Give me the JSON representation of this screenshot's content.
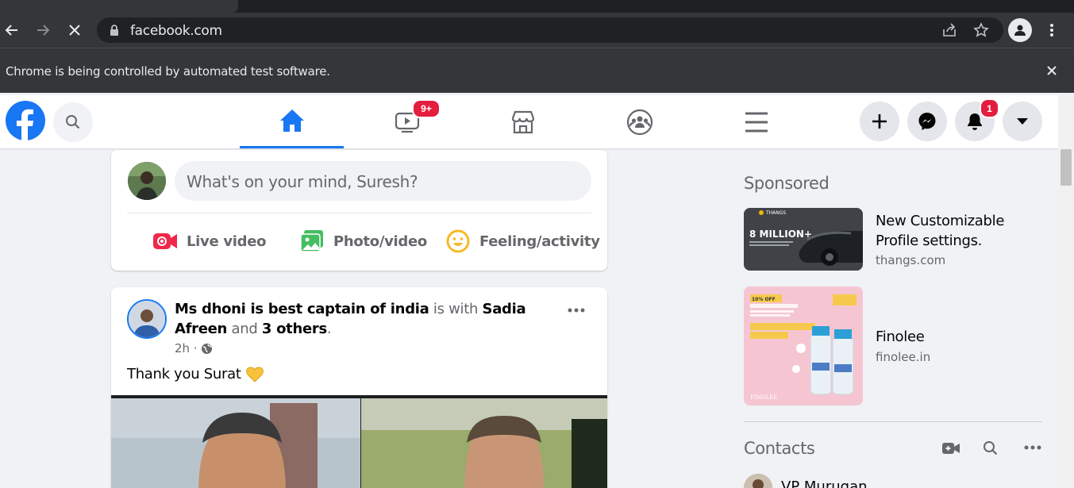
{
  "browser": {
    "url": "facebook.com",
    "infobar_message": "Chrome is being controlled by automated test software."
  },
  "header": {
    "watch_badge": "9+",
    "notifications_badge": "1"
  },
  "composer": {
    "placeholder": "What's on your mind, Suresh?",
    "live_video": "Live video",
    "photo_video": "Photo/video",
    "feeling": "Feeling/activity"
  },
  "post": {
    "author": "Ms dhoni is best captain of india",
    "with_text": "is with",
    "tagged": "Sadia Afreen",
    "and_text": "and",
    "others": "3 others",
    "period": ".",
    "time": "2h ·",
    "text": "Thank you Surat"
  },
  "sidebar": {
    "sponsored_heading": "Sponsored",
    "ads": [
      {
        "title": "New Customizable Profile settings.",
        "domain": "thangs.com",
        "image_text": "8 MILLION+",
        "image_brand": "THANGS"
      },
      {
        "title": "Finolee",
        "domain": "finolee.in",
        "image_text": "10% OFF",
        "image_brand": "FINOLEE"
      }
    ],
    "contacts_heading": "Contacts",
    "contacts": [
      {
        "name": "VP Murugan"
      }
    ]
  },
  "colors": {
    "fb_blue": "#1877f2",
    "badge_red": "#e41e3f",
    "chrome_dark": "#35363a"
  }
}
